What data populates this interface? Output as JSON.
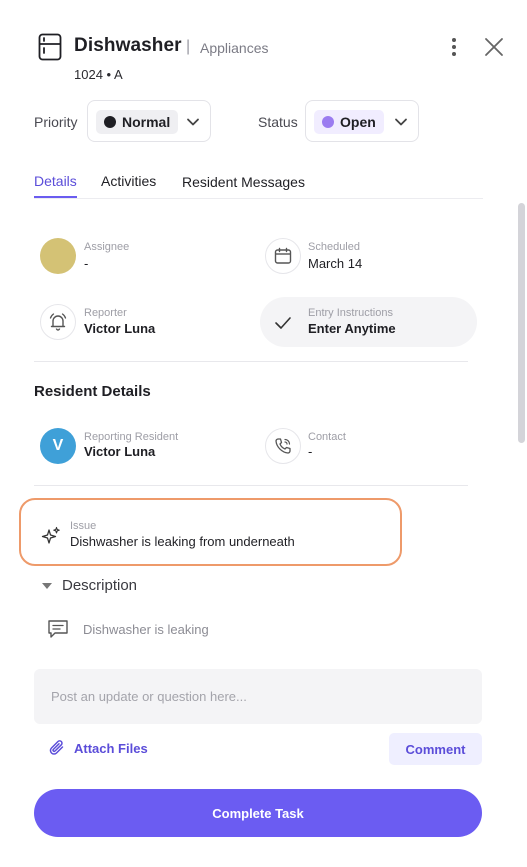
{
  "header": {
    "title": "Dishwasher",
    "separator": "|",
    "category": "Appliances",
    "unit": "1024 • A",
    "icon": "appliance-icon"
  },
  "priority": {
    "label": "Priority",
    "value": "Normal",
    "color": "#1f1f24"
  },
  "status": {
    "label": "Status",
    "value": "Open",
    "color": "#9b7cf0"
  },
  "tabs": [
    {
      "label": "Details",
      "active": true
    },
    {
      "label": "Activities",
      "active": false
    },
    {
      "label": "Resident Messages",
      "active": false
    }
  ],
  "details": {
    "assignee": {
      "label": "Assignee",
      "value": "-"
    },
    "scheduled": {
      "label": "Scheduled",
      "value": "March 14"
    },
    "reporter": {
      "label": "Reporter",
      "value": "Victor Luna"
    },
    "entry": {
      "label": "Entry Instructions",
      "value": "Enter Anytime"
    }
  },
  "resident": {
    "section_title": "Resident Details",
    "avatar_initial": "V",
    "reporting": {
      "label": "Reporting Resident",
      "value": "Victor Luna"
    },
    "contact": {
      "label": "Contact",
      "value": "-"
    }
  },
  "issue": {
    "label": "Issue",
    "value": "Dishwasher is leaking from underneath"
  },
  "description": {
    "title": "Description",
    "text": "Dishwasher is leaking"
  },
  "composer": {
    "placeholder": "Post an update or question here..."
  },
  "actions": {
    "attach": "Attach Files",
    "comment": "Comment",
    "complete": "Complete Task"
  },
  "colors": {
    "accent": "#6b5cf2",
    "issue_outline": "#ee9a6a",
    "assignee_avatar": "#d4c275",
    "resident_avatar": "#3fa0d8"
  }
}
